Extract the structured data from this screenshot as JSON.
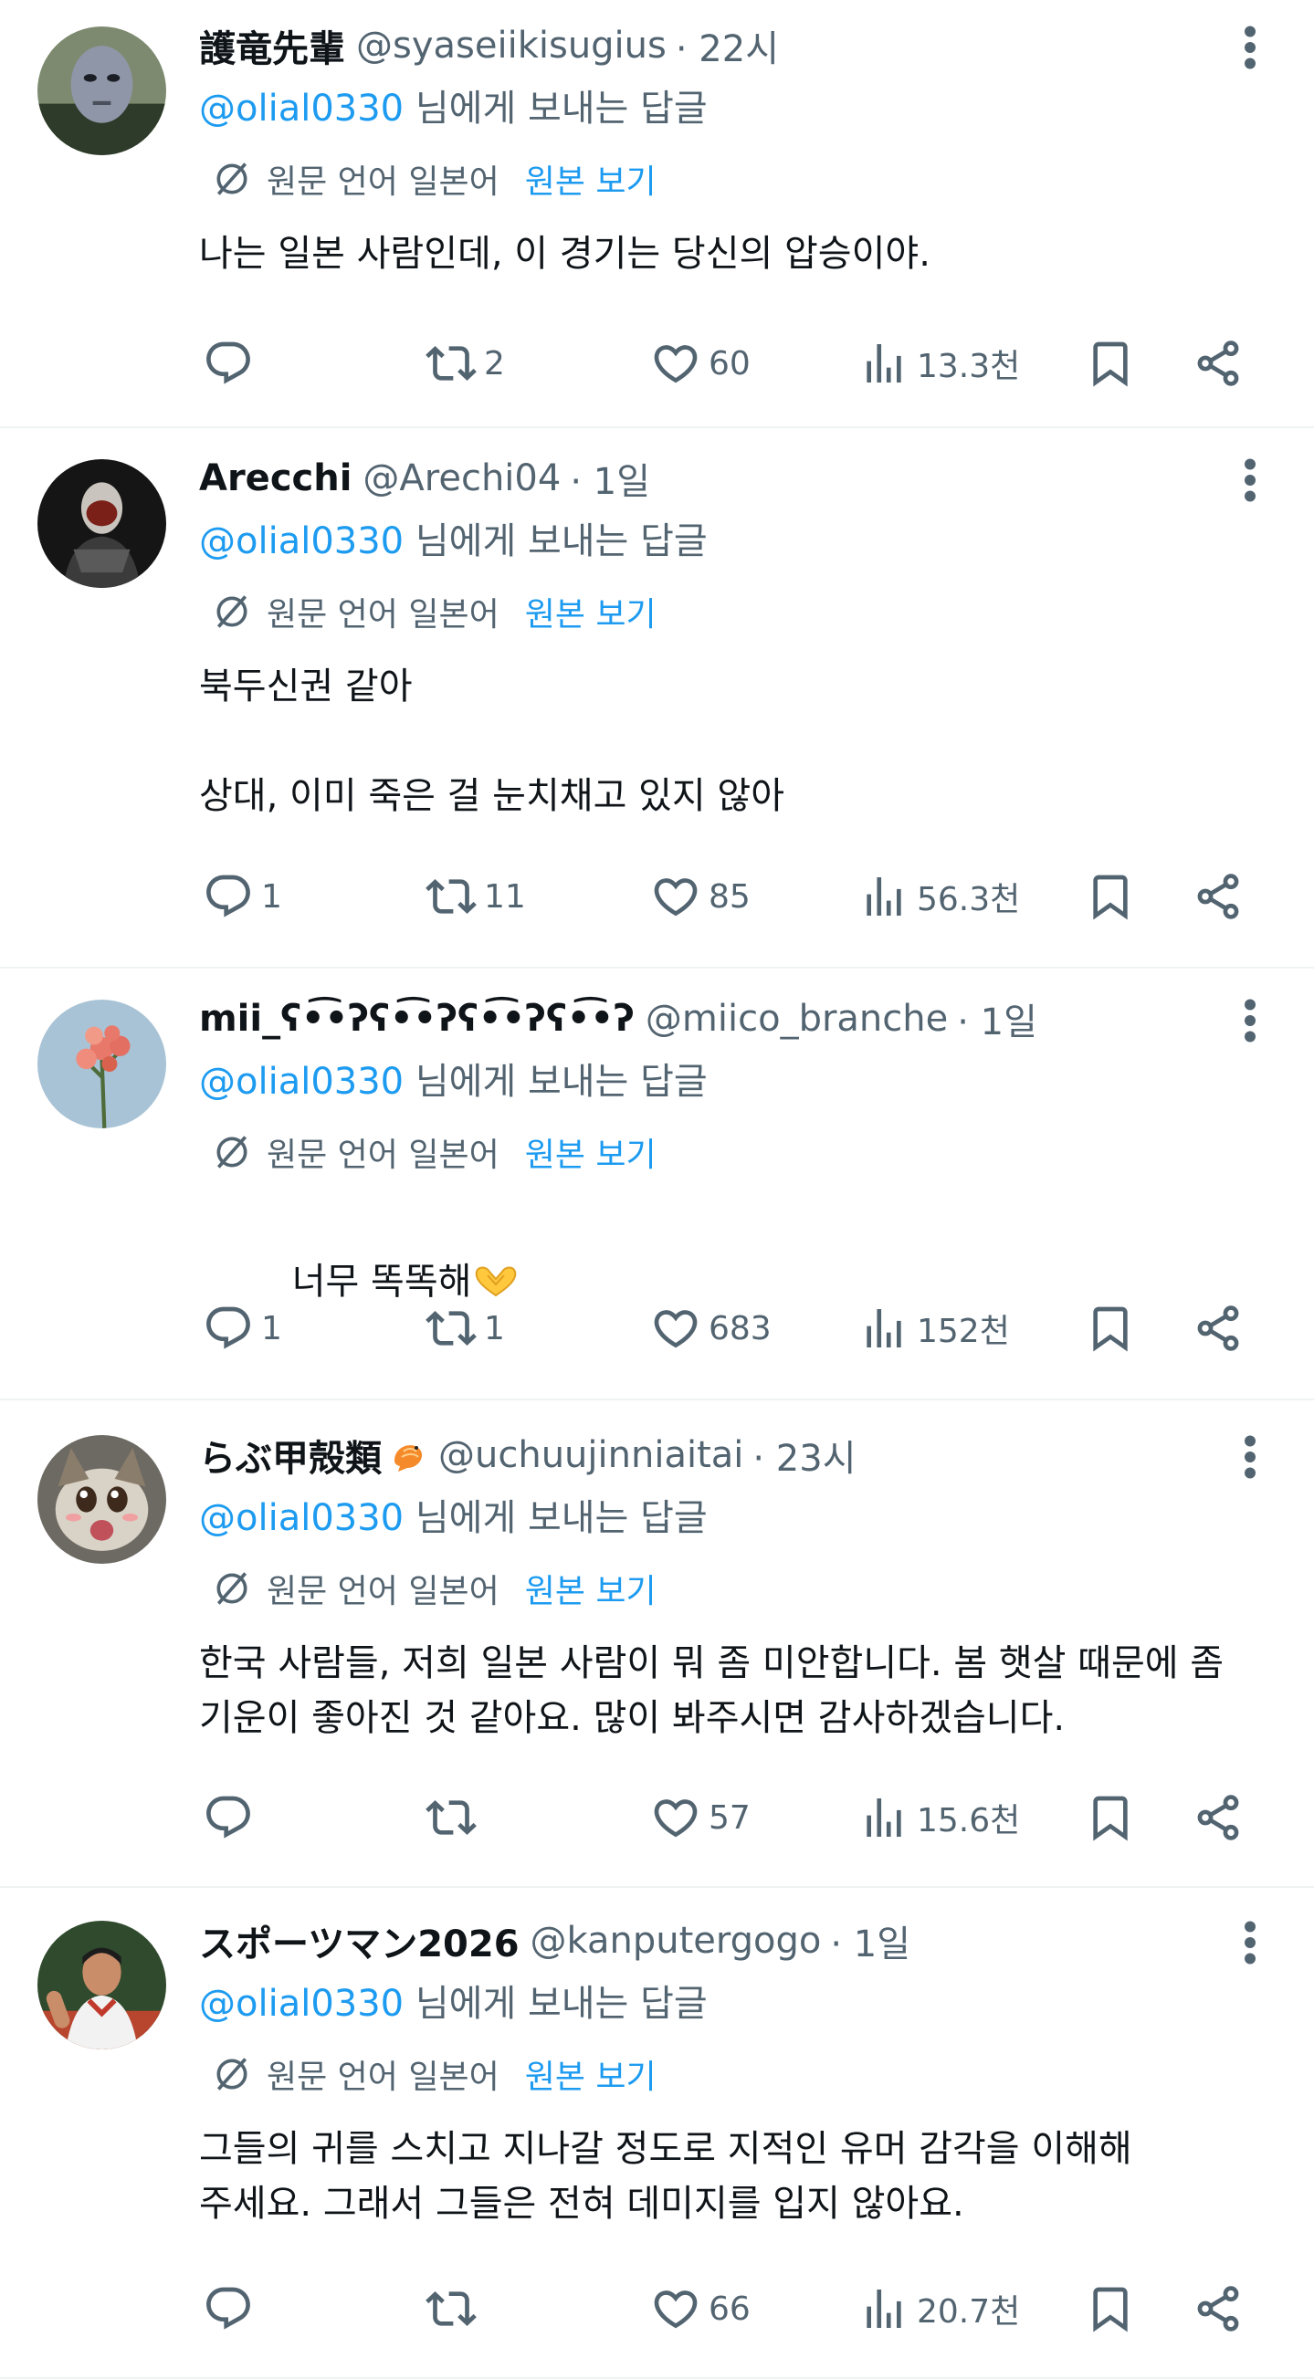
{
  "colors": {
    "primary_text": "#0f1419",
    "secondary_text": "#536471",
    "link": "#1d9bf0",
    "divider": "#eff3f4"
  },
  "tweets": [
    {
      "name": "護竜先輩",
      "handle": "@syaseiikisugius",
      "time": "· 22시",
      "reply_mention": "@olial0330",
      "reply_suffix": " 님에게 보내는 답글",
      "translate_label": "원문 언어 일본어",
      "show_original": "원본 보기",
      "text": "나는 일본 사람인데, 이 경기는 당신의 압승이야.",
      "replies": "",
      "retweets": "2",
      "likes": "60",
      "views": "13.3천"
    },
    {
      "name": "Arecchi",
      "handle": "@Arechi04",
      "time": "· 1일",
      "reply_mention": "@olial0330",
      "reply_suffix": " 님에게 보내는 답글",
      "translate_label": "원문 언어 일본어",
      "show_original": "원본 보기",
      "text": "북두신권 같아\n\n상대, 이미 죽은 걸 눈치채고 있지 않아",
      "replies": "1",
      "retweets": "11",
      "likes": "85",
      "views": "56.3천"
    },
    {
      "name": "mii_ʕ•͡•ʔʕ•͡•ʔʕ•͡•ʔʕ•͡•ʔ",
      "handle": "@miico_branche",
      "time": "· 1일",
      "reply_mention": "@olial0330",
      "reply_suffix": " 님에게 보내는 답글",
      "translate_label": "원문 언어 일본어",
      "show_original": "원본 보기",
      "text": "너무 똑똑해",
      "replies": "1",
      "retweets": "1",
      "likes": "683",
      "views": "152천"
    },
    {
      "name": "らぶ甲殻類",
      "handle": "@uchuujinniaitai",
      "time": "· 23시",
      "reply_mention": "@olial0330",
      "reply_suffix": " 님에게 보내는 답글",
      "translate_label": "원문 언어 일본어",
      "show_original": "원본 보기",
      "text": "한국 사람들, 저희 일본 사람이 뭐 좀 미안합니다. 봄 햇살 때문에 좀\n기운이 좋아진 것 같아요. 많이 봐주시면 감사하겠습니다.",
      "replies": "",
      "retweets": "",
      "likes": "57",
      "views": "15.6천"
    },
    {
      "name": "スポーツマン2026",
      "handle": "@kanputergogo",
      "time": "· 1일",
      "reply_mention": "@olial0330",
      "reply_suffix": " 님에게 보내는 답글",
      "translate_label": "원문 언어 일본어",
      "show_original": "원본 보기",
      "text": "그들의 귀를 스치고 지나갈 정도로 지적인 유머 감각을 이해해\n주세요. 그래서 그들은 전혀 데미지를 입지 않아요.",
      "replies": "",
      "retweets": "",
      "likes": "66",
      "views": "20.7천"
    }
  ]
}
